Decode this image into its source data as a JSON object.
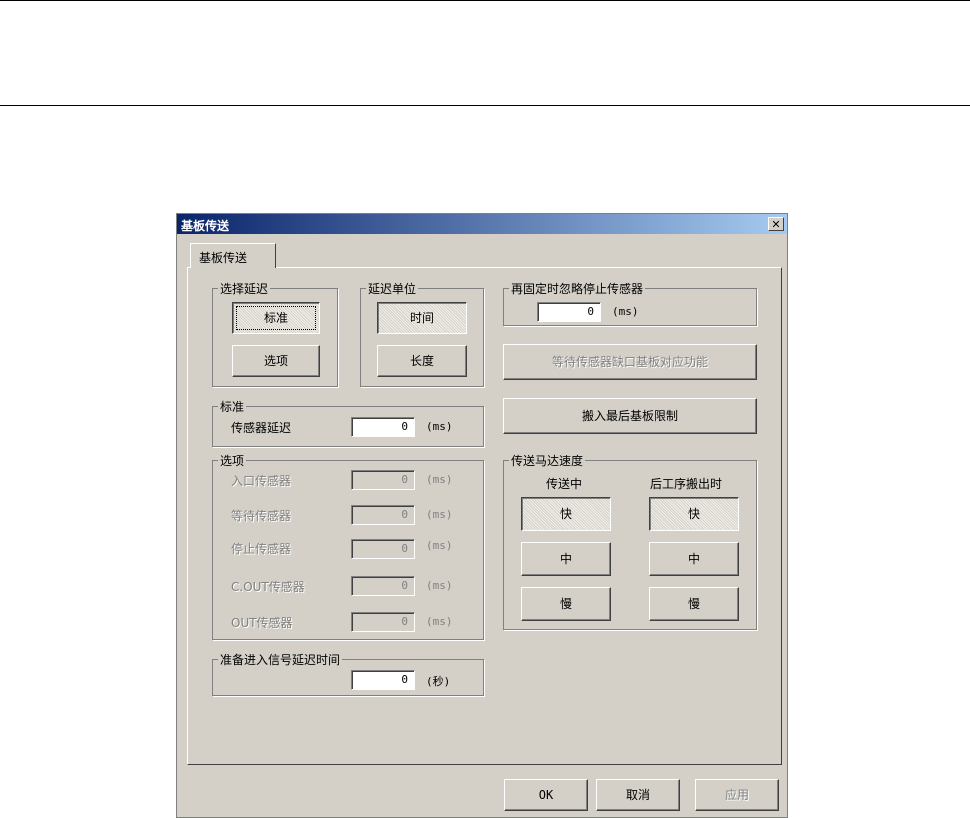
{
  "dialog": {
    "title": "基板传送",
    "close_glyph": "✕"
  },
  "tab": {
    "label": "基板传送"
  },
  "select_delay": {
    "legend": "选择延迟",
    "standard": "标准",
    "option": "选项"
  },
  "delay_unit": {
    "legend": "延迟单位",
    "time": "时间",
    "length": "长度"
  },
  "standard_group": {
    "legend": "标准",
    "sensor_delay_label": "传感器延迟",
    "sensor_delay_value": "0",
    "unit": "(ms)"
  },
  "options_group": {
    "legend": "选项",
    "rows": [
      {
        "label": "入口传感器",
        "value": "0",
        "unit": "(ms)"
      },
      {
        "label": "等待传感器",
        "value": "0",
        "unit": "(ms)"
      },
      {
        "label": "停止传感器",
        "value": "0",
        "unit": "(ms)"
      },
      {
        "label": "C.OUT传感器",
        "value": "0",
        "unit": "(ms)"
      },
      {
        "label": "OUT传感器",
        "value": "0",
        "unit": "(ms)"
      }
    ]
  },
  "ready_signal": {
    "legend": "准备进入信号延迟时间",
    "value": "0",
    "unit": "(秒)"
  },
  "refix": {
    "legend": "再固定时忽略停止传感器",
    "value": "0",
    "unit": "(ms)"
  },
  "wait_sensor_button": "等待传感器缺口基板对应功能",
  "carry_in_limit_button": "搬入最后基板限制",
  "motor_speed": {
    "legend": "传送马达速度",
    "col_transfer": "传送中",
    "col_after": "后工序搬出时",
    "fast": "快",
    "medium": "中",
    "slow": "慢"
  },
  "footer": {
    "ok": "OK",
    "cancel": "取消",
    "apply": "应用"
  }
}
